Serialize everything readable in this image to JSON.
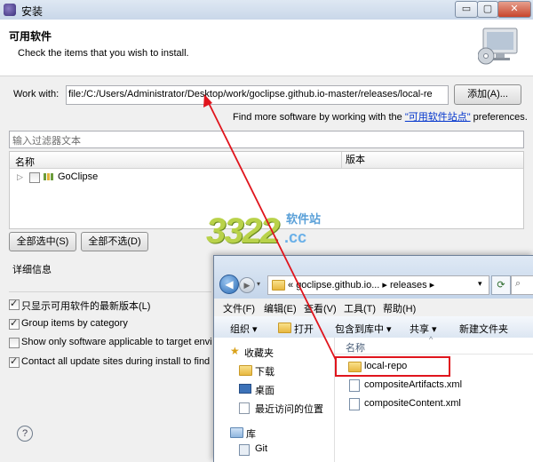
{
  "window": {
    "title": "安装",
    "min": "▭",
    "max": "▢",
    "close": "✕"
  },
  "header": {
    "title": "可用软件",
    "subtitle": "Check the items that you wish to install."
  },
  "work_with": {
    "label": "Work with:",
    "value": "file:/C:/Users/Administrator/Desktop/work/goclipse.github.io-master/releases/local-re",
    "add_button": "添加(A)...",
    "find_prefix": "Find more software by working with the ",
    "find_link": "\"可用软件站点\"",
    "find_suffix": " preferences."
  },
  "filter": {
    "placeholder": "输入过滤器文本"
  },
  "tree": {
    "col_name": "名称",
    "col_version": "版本",
    "items": [
      {
        "label": "GoClipse",
        "checked": false
      }
    ]
  },
  "buttons": {
    "select_all": "全部选中(S)",
    "deselect_all": "全部不选(D)"
  },
  "details": {
    "label": "详细信息"
  },
  "options": [
    {
      "label": "只显示可用软件的最新版本(L)",
      "checked": true
    },
    {
      "label": "Group items by category",
      "checked": true
    },
    {
      "label": "Show only software applicable to target envi",
      "checked": false
    },
    {
      "label": "Contact all update sites during install to find",
      "checked": true
    }
  ],
  "help": {
    "icon": "?"
  },
  "watermark": {
    "number": "3322",
    "cn": "软件站",
    "domain": ".cc"
  },
  "explorer": {
    "breadcrumb": [
      "«",
      "goclipse.github.io...",
      "▸",
      "releases",
      "▸"
    ],
    "search_icon": "⌕",
    "menu": [
      "文件(F)",
      "编辑(E)",
      "查看(V)",
      "工具(T)",
      "帮助(H)"
    ],
    "toolbar": [
      "组织 ▾",
      "打开",
      "包含到库中 ▾",
      "共享 ▾",
      "新建文件夹"
    ],
    "column_name": "名称",
    "nav": [
      {
        "label": "收藏夹",
        "icon": "star-icon"
      },
      {
        "label": "下载",
        "icon": "download-folder-icon"
      },
      {
        "label": "桌面",
        "icon": "desktop-icon"
      },
      {
        "label": "最近访问的位置",
        "icon": "recent-places-icon"
      },
      {
        "label": "库",
        "icon": "library-icon"
      },
      {
        "label": "Git",
        "icon": "git-library-icon"
      }
    ],
    "files": [
      {
        "name": "local-repo",
        "type": "folder",
        "highlighted": true
      },
      {
        "name": "compositeArtifacts.xml",
        "type": "xml"
      },
      {
        "name": "compositeContent.xml",
        "type": "xml"
      }
    ]
  },
  "colors": {
    "highlight": "#e0151d",
    "link": "#0033cc"
  }
}
